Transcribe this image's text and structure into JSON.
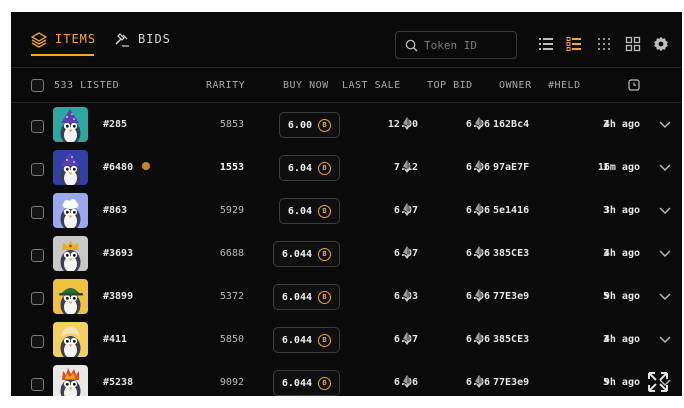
{
  "tabs": {
    "items": "ITEMS",
    "bids": "BIDS"
  },
  "search": {
    "placeholder": "Token ID"
  },
  "header": {
    "listed": "533 LISTED",
    "rarity": "RARITY",
    "buy_now": "BUY NOW",
    "last_sale": "LAST SALE",
    "top_bid": "TOP BID",
    "owner": "OWNER",
    "held": "#HELD"
  },
  "colors": {
    "accent": "#f5a623",
    "background": "#0a0a0a"
  },
  "rows": [
    {
      "name": "#285",
      "rarity": "5853",
      "buy_now": "6.00",
      "last_sale": "12.00",
      "top_bid": "6.06",
      "owner": "162Bc4",
      "held": "2",
      "time": "4h ago",
      "bg": "#2ba8a0",
      "hat": "wizard-hat"
    },
    {
      "name": "#6480",
      "rarity": "1553",
      "buy_now": "6.04",
      "last_sale": "7.12",
      "top_bid": "6.06",
      "owner": "97aE7F",
      "held": "1",
      "time": "16m ago",
      "bg": "#3040a8",
      "hat": "wizard-hat"
    },
    {
      "name": "#863",
      "rarity": "5929",
      "buy_now": "6.04",
      "last_sale": "6.07",
      "top_bid": "6.06",
      "owner": "5e1416",
      "held": "3",
      "time": "3h ago",
      "bg": "#9aa8f0",
      "hat": "cloud-cap"
    },
    {
      "name": "#3693",
      "rarity": "6688",
      "buy_now": "6.044",
      "last_sale": "6.07",
      "top_bid": "6.06",
      "owner": "385CE3",
      "held": "3",
      "time": "4h ago",
      "bg": "#c8c8c8",
      "hat": "crown"
    },
    {
      "name": "#3899",
      "rarity": "5372",
      "buy_now": "6.044",
      "last_sale": "6.03",
      "top_bid": "6.06",
      "owner": "77E3e9",
      "held": "5",
      "time": "9h ago",
      "bg": "#f0c040",
      "hat": "green-cap"
    },
    {
      "name": "#411",
      "rarity": "5850",
      "buy_now": "6.044",
      "last_sale": "6.07",
      "top_bid": "6.06",
      "owner": "385CE3",
      "held": "3",
      "time": "4h ago",
      "bg": "#f5d060",
      "hat": "cream-hair"
    },
    {
      "name": "#5238",
      "rarity": "9092",
      "buy_now": "6.044",
      "last_sale": "6.06",
      "top_bid": "6.06",
      "owner": "77E3e9",
      "held": "5",
      "time": "9h ago",
      "bg": "#e8e8e8",
      "hat": "flame-hair"
    }
  ]
}
